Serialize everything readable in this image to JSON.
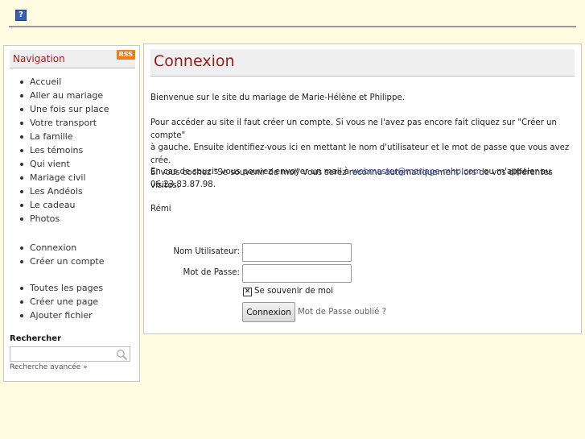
{
  "header": {
    "help_glyph": "?"
  },
  "sidebar": {
    "title": "Navigation",
    "rss": "RSS",
    "groups": [
      [
        "Accueil",
        "Aller au mariage",
        "Une fois sur place",
        "Votre transport",
        "La famille",
        "Les témoins",
        "Qui vient",
        "Mariage civil",
        "Les Andéols",
        "Le cadeau",
        "Photos"
      ],
      [
        "Connexion",
        "Créer un compte"
      ],
      [
        "Toutes les pages",
        "Créer une page",
        "Ajouter fichier"
      ]
    ],
    "search": {
      "label": "Rechercher",
      "value": "",
      "advanced": "Recherche avancée »"
    }
  },
  "main": {
    "title": "Connexion",
    "intro": "Bienvenue sur le site du mariage de Marie-Hélène et Philippe.",
    "instructions": [
      "Pour accéder au site il faut créer un compte. Si vous ne l'avez pas encore fait cliquez sur \"Créer un compte\"",
      "à gauche. Ensuite identifiez-vous ici en mettant le nom d'utilisateur et le mot de passe que vous avez crée.",
      "Si vous cochez \"Se souvenir de moi\" vous serez reconnu automatiquement lors de vos différentes visites."
    ],
    "contact_prefix": "En cas de soucis vous pouvez envoyer un mail à ",
    "contact_email": "webmaster@mariage-mhp.com",
    "contact_suffix": " ou m'appeler au",
    "contact_phone": "06.23.83.87.98.",
    "signature": "Rémi",
    "form": {
      "username_label": "Nom Utilisateur:",
      "username_value": "",
      "password_label": "Mot de Passe:",
      "password_value": "",
      "remember_label": "Se souvenir de moi",
      "remember_checked": true,
      "submit_label": "Connexion",
      "forgot_label": "Mot de Passe oublié ?"
    }
  }
}
